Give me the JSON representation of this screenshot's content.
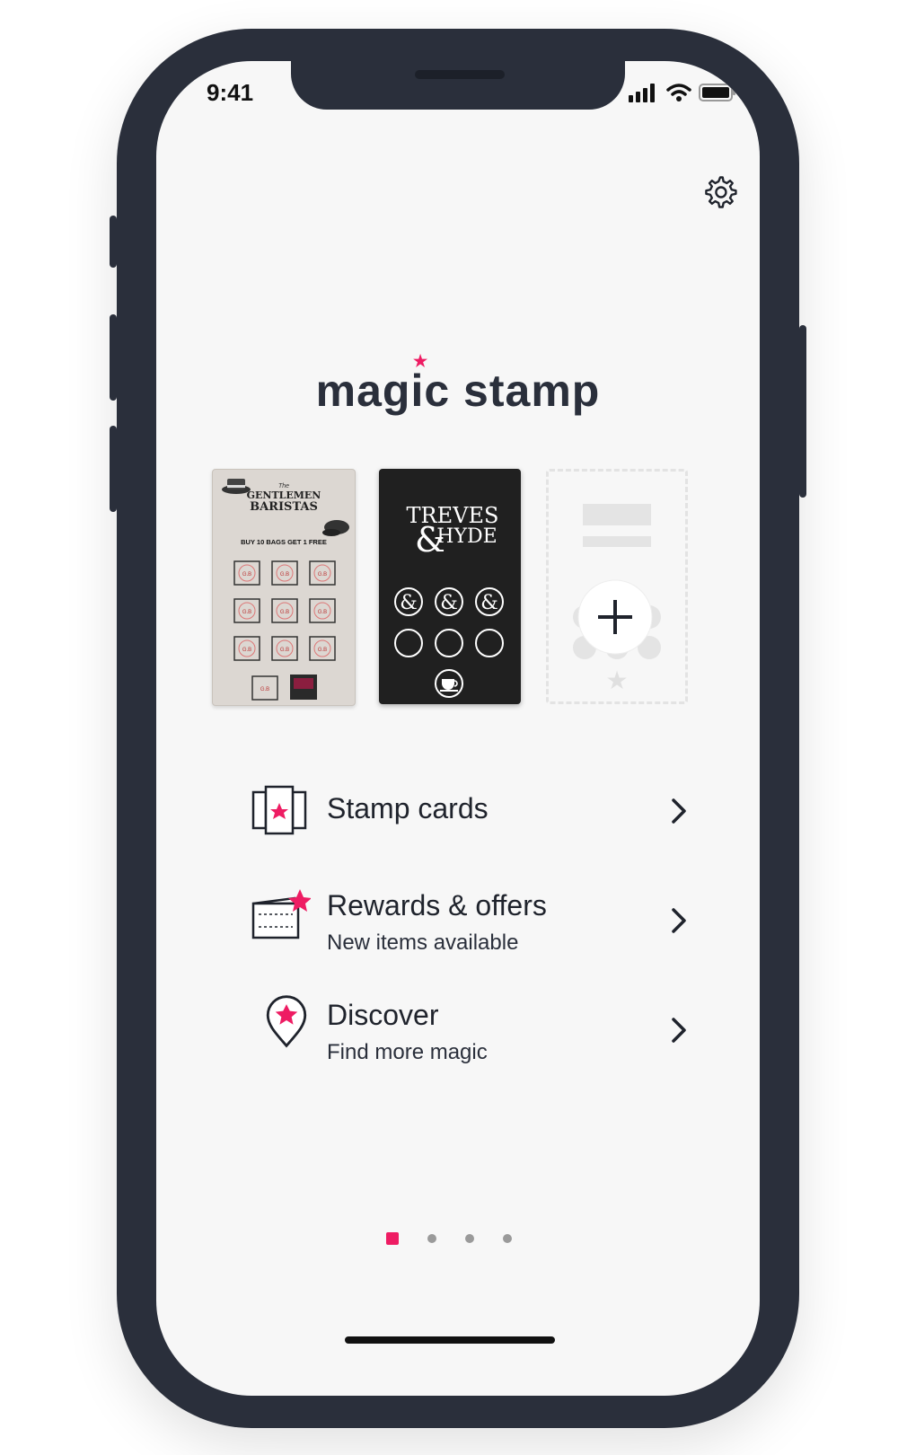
{
  "status": {
    "time": "9:41"
  },
  "brand": {
    "name": "magic stamp",
    "accent": "#ee1c63"
  },
  "cards": [
    {
      "title_small": "The",
      "title_1": "GENTLEMEN",
      "title_2": "BARISTAS",
      "offer": "BUY 10 BAGS GET 1 FREE",
      "stamp_text": "G.B"
    },
    {
      "title_1": "TREVES",
      "title_2": "HYDE"
    },
    {
      "label": "add-card"
    }
  ],
  "menu": [
    {
      "title": "Stamp cards",
      "subtitle": ""
    },
    {
      "title": "Rewards & offers",
      "subtitle": "New items available"
    },
    {
      "title": "Discover",
      "subtitle": "Find more magic"
    }
  ],
  "pagination": {
    "current": 1,
    "total": 4
  }
}
